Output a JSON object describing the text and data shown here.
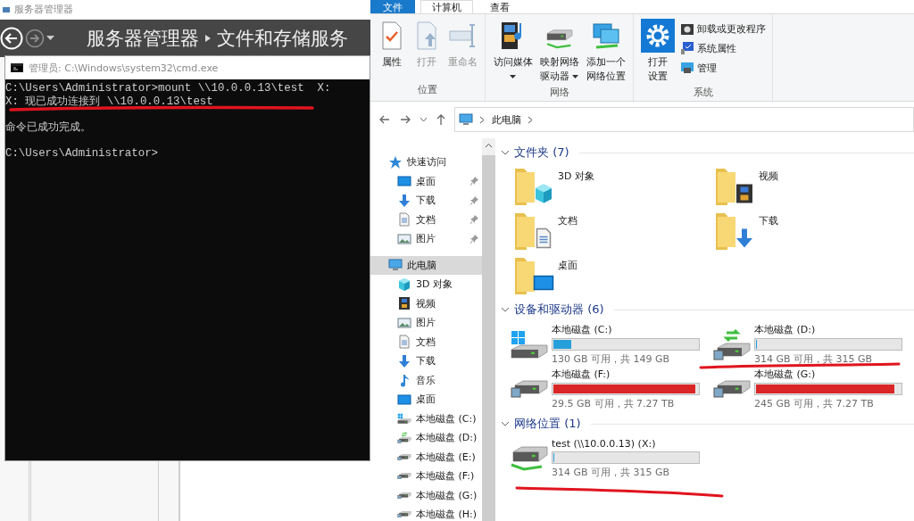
{
  "server_manager": {
    "title": "服务器管理器",
    "breadcrumb": [
      "服务器管理器",
      "文件和存储服务"
    ]
  },
  "cmd": {
    "title": "管理员: C:\\Windows\\system32\\cmd.exe",
    "blocks": [
      [
        "C:\\Users\\Administrator>mount \\\\10.0.0.13\\test  X:",
        "X: 现已成功连接到 \\\\10.0.0.13\\test"
      ],
      [
        "命令已成功完成。"
      ],
      [
        "C:\\Users\\Administrator>"
      ]
    ]
  },
  "explorer": {
    "ribbon_tabs": [
      {
        "label": "文件",
        "kind": "file",
        "selected": false
      },
      {
        "label": "计算机",
        "kind": "tab",
        "selected": true
      },
      {
        "label": "查看",
        "kind": "tab",
        "selected": false
      }
    ],
    "ribbon_groups": [
      {
        "label": "位置",
        "buttons": [
          {
            "label": "属性",
            "kind": "properties",
            "disabled": false,
            "dropdown": false
          },
          {
            "label": "打开",
            "kind": "open",
            "disabled": true,
            "dropdown": false
          },
          {
            "label": "重命名",
            "kind": "rename",
            "disabled": true,
            "dropdown": false
          }
        ]
      },
      {
        "label": "网络",
        "buttons": [
          {
            "label": "访问媒体",
            "kind": "media",
            "disabled": false,
            "dropdown": true
          },
          {
            "label": "映射网络驱动器",
            "kind": "mapdrive",
            "disabled": false,
            "dropdown": true
          },
          {
            "label": "添加一个网络位置",
            "kind": "addlocation",
            "disabled": false,
            "dropdown": false
          }
        ]
      },
      {
        "label": "系统",
        "buttons": [
          {
            "label": "打开设置",
            "kind": "settings",
            "disabled": false,
            "dropdown": false
          }
        ],
        "small_buttons": [
          {
            "label": "卸载或更改程序",
            "kind": "uninstall"
          },
          {
            "label": "系统属性",
            "kind": "sysprops"
          },
          {
            "label": "管理",
            "kind": "manage"
          }
        ]
      }
    ],
    "address": {
      "path": [
        "此电脑"
      ]
    },
    "nav": [
      {
        "label": "快速访问",
        "kind": "star",
        "selected": false,
        "children": [
          {
            "label": "桌面",
            "kind": "desktop",
            "pinned": true,
            "selected": false
          },
          {
            "label": "下载",
            "kind": "download",
            "pinned": true,
            "selected": false
          },
          {
            "label": "文档",
            "kind": "document",
            "pinned": true,
            "selected": false
          },
          {
            "label": "图片",
            "kind": "picture",
            "pinned": true,
            "selected": false
          }
        ]
      },
      {
        "label": "此电脑",
        "kind": "computer",
        "selected": true,
        "children": [
          {
            "label": "3D 对象",
            "kind": "cube",
            "pinned": false,
            "selected": false
          },
          {
            "label": "视频",
            "kind": "video",
            "pinned": false,
            "selected": false
          },
          {
            "label": "图片",
            "kind": "picture",
            "pinned": false,
            "selected": false
          },
          {
            "label": "文档",
            "kind": "document",
            "pinned": false,
            "selected": false
          },
          {
            "label": "下载",
            "kind": "download",
            "pinned": false,
            "selected": false
          },
          {
            "label": "音乐",
            "kind": "music",
            "pinned": false,
            "selected": false
          },
          {
            "label": "桌面",
            "kind": "desktop",
            "pinned": false,
            "selected": false
          },
          {
            "label": "本地磁盘 (C:)",
            "kind": "system",
            "pinned": false,
            "selected": false
          },
          {
            "label": "本地磁盘 (D:)",
            "kind": "sync",
            "pinned": false,
            "selected": false
          },
          {
            "label": "本地磁盘 (E:)",
            "kind": "shared",
            "pinned": false,
            "selected": false
          },
          {
            "label": "本地磁盘 (F:)",
            "kind": "shared",
            "pinned": false,
            "selected": false
          },
          {
            "label": "本地磁盘 (G:)",
            "kind": "shared",
            "pinned": false,
            "selected": false
          },
          {
            "label": "本地磁盘 (H:)",
            "kind": "shared",
            "pinned": false,
            "selected": false
          }
        ]
      }
    ],
    "folders": {
      "title": "文件夹 (7)",
      "expanded": true,
      "items": [
        {
          "name": "3D 对象",
          "kind": "cube"
        },
        {
          "name": "视频",
          "kind": "video"
        },
        {
          "name": "文档",
          "kind": "document"
        },
        {
          "name": "下载",
          "kind": "download"
        },
        {
          "name": "桌面",
          "kind": "desktop"
        }
      ]
    },
    "drives": {
      "title": "设备和驱动器 (6)",
      "expanded": true,
      "items": [
        {
          "name": "本地磁盘 (C:)",
          "kind": "system",
          "level": 0.128,
          "low_space": false,
          "free": "130 GB 可用，共 149 GB"
        },
        {
          "name": "本地磁盘 (D:)",
          "kind": "sync",
          "level": 0.003,
          "low_space": false,
          "free": "314 GB 可用，共 315 GB"
        },
        {
          "name": "本地磁盘 (F:)",
          "kind": "shared",
          "level": 0.996,
          "low_space": true,
          "free": "29.5 GB 可用，共 7.27 TB"
        },
        {
          "name": "本地磁盘 (G:)",
          "kind": "shared",
          "level": 0.967,
          "low_space": true,
          "free": "245 GB 可用，共 7.27 TB"
        }
      ]
    },
    "network": {
      "title": "网络位置 (1)",
      "expanded": true,
      "items": [
        {
          "name": "test (\\\\10.0.0.13) (X:)",
          "kind": "network",
          "level": 0.003,
          "low_space": false,
          "free": "314 GB 可用，共 315 GB"
        }
      ]
    }
  }
}
